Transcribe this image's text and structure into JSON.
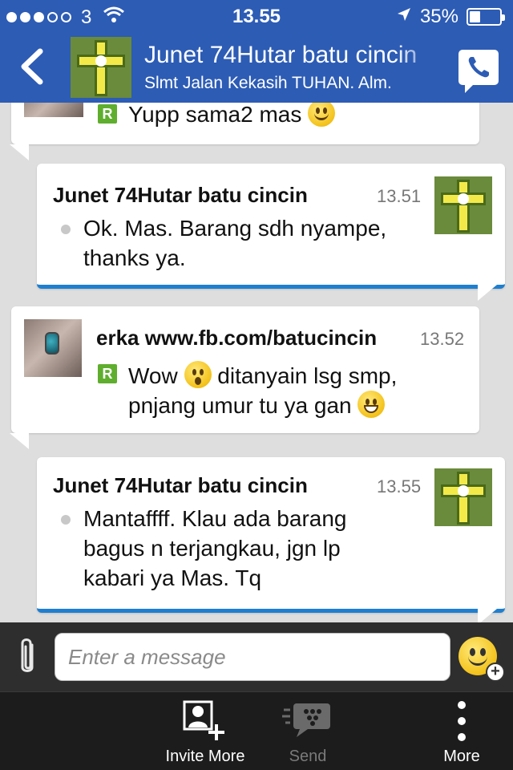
{
  "status_bar": {
    "carrier": "3",
    "time": "13.55",
    "battery": "35%",
    "battery_level": 0.35
  },
  "header": {
    "title": "Junet 74Hutar batu cincin",
    "subtitle": "Slmt Jalan Kekasih TUHAN. Alm."
  },
  "messages": [
    {
      "direction": "incoming",
      "text": "Yupp sama2 mas",
      "emoji": "smile"
    },
    {
      "direction": "outgoing",
      "sender": "Junet 74Hutar batu cincin",
      "time": "13.51",
      "text": "Ok. Mas. Barang sdh nyampe, thanks ya."
    },
    {
      "direction": "incoming",
      "sender": "erka www.fb.com/batucincin",
      "time": "13.52",
      "text_part1": "Wow",
      "text_part2": "ditanyain lsg smp,",
      "text_part3": "pnjang umur tu ya gan",
      "emoji": [
        "surprised",
        "grin"
      ]
    },
    {
      "direction": "outgoing",
      "sender": "Junet 74Hutar batu cincin",
      "time": "13.55",
      "text": "Mantaffff. Klau ada barang bagus n terjangkau, jgn lp kabari ya Mas. Tq"
    }
  ],
  "composer": {
    "placeholder": "Enter a message"
  },
  "toolbar": {
    "invite_label": "Invite More",
    "send_label": "Send",
    "more_label": "More"
  },
  "colors": {
    "header_blue": "#2d5cb5",
    "outgoing_accent": "#1e7fd0",
    "chat_background": "#dedede",
    "read_badge": "#5fae2e"
  },
  "icons": [
    "wifi-icon",
    "location-arrow-icon",
    "battery-icon",
    "back-icon",
    "call-icon",
    "read-badge-icon",
    "attach-icon",
    "emoji-add-icon",
    "invite-icon",
    "send-icon",
    "more-icon"
  ]
}
